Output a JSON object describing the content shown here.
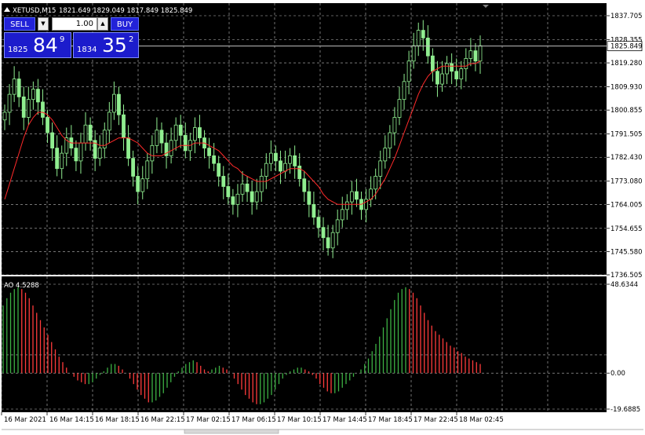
{
  "header": {
    "symbol": "XETUSD,M15",
    "ohlc": "1821.649 1829.049 1817.849 1825.849"
  },
  "trade_panel": {
    "sell_label": "SELL",
    "buy_label": "BUY",
    "lot": "1.00",
    "sell_prefix": "1825",
    "sell_big": "84",
    "sell_sup": "9",
    "buy_prefix": "1834",
    "buy_big": "35",
    "buy_sup": "2"
  },
  "indicator": {
    "label": "AO 4.5288"
  },
  "current_price": "1825.849",
  "colors": {
    "background": "#000000",
    "grid": "#c0c0c0",
    "candle": "#90ee90",
    "ma": "#ff2a2a",
    "ao_up": "#3cb043",
    "ao_down": "#ff3b3b",
    "panel": "#1c1ccc"
  },
  "chart_data": [
    {
      "type": "candlestick",
      "title": "XETUSD,M15",
      "y_ticks": [
        "1837.705",
        "1828.355",
        "1819.280",
        "1809.930",
        "1800.855",
        "1791.505",
        "1782.430",
        "1773.080",
        "1764.005",
        "1754.655",
        "1745.580",
        "1736.505"
      ],
      "ylim": [
        1736.505,
        1837.705
      ],
      "x_ticks": [
        "16 Mar 2021",
        "16 Mar 14:15",
        "16 Mar 18:15",
        "16 Mar 22:15",
        "17 Mar 02:15",
        "17 Mar 06:15",
        "17 Mar 10:15",
        "17 Mar 14:45",
        "17 Mar 18:45",
        "17 Mar 22:45",
        "18 Mar 02:45"
      ],
      "series": [
        {
          "name": "price",
          "values": [
            1800,
            1807,
            1813,
            1806,
            1798,
            1805,
            1809,
            1804,
            1798,
            1792,
            1786,
            1778,
            1784,
            1790,
            1786,
            1781,
            1788,
            1795,
            1789,
            1782,
            1786,
            1793,
            1800,
            1807,
            1799,
            1790,
            1782,
            1775,
            1769,
            1774,
            1781,
            1787,
            1793,
            1788,
            1783,
            1789,
            1795,
            1791,
            1785,
            1789,
            1794,
            1790,
            1786,
            1783,
            1780,
            1775,
            1771,
            1767,
            1764,
            1768,
            1772,
            1769,
            1765,
            1769,
            1775,
            1780,
            1784,
            1781,
            1777,
            1780,
            1783,
            1779,
            1774,
            1769,
            1764,
            1759,
            1755,
            1751,
            1747,
            1753,
            1758,
            1762,
            1765,
            1769,
            1766,
            1762,
            1766,
            1770,
            1775,
            1781,
            1786,
            1792,
            1798,
            1805,
            1812,
            1820,
            1826,
            1832,
            1829,
            1822,
            1816,
            1811,
            1815,
            1819,
            1816,
            1813,
            1817,
            1821,
            1824,
            1820,
            1826
          ]
        },
        {
          "name": "ma",
          "values": [
            1766,
            1772,
            1778,
            1784,
            1790,
            1795,
            1798,
            1800,
            1800,
            1799,
            1797,
            1794,
            1791,
            1789,
            1788,
            1788,
            1788,
            1788,
            1788,
            1788,
            1787,
            1787,
            1788,
            1789,
            1790,
            1790,
            1790,
            1789,
            1788,
            1786,
            1784,
            1783,
            1783,
            1783,
            1784,
            1785,
            1786,
            1787,
            1787,
            1787,
            1788,
            1788,
            1788,
            1787,
            1786,
            1785,
            1783,
            1781,
            1779,
            1778,
            1776,
            1775,
            1774,
            1773,
            1773,
            1773,
            1774,
            1775,
            1776,
            1777,
            1778,
            1778,
            1778,
            1777,
            1775,
            1773,
            1771,
            1768,
            1766,
            1765,
            1764,
            1764,
            1764,
            1764,
            1764,
            1764,
            1765,
            1766,
            1768,
            1771,
            1774,
            1778,
            1782,
            1787,
            1792,
            1797,
            1802,
            1807,
            1811,
            1814,
            1816,
            1817,
            1818,
            1818,
            1818,
            1818,
            1818,
            1818,
            1819,
            1819,
            1820
          ]
        }
      ],
      "current_price": 1825.849
    },
    {
      "type": "histogram",
      "title": "AO 4.5288",
      "y_ticks": [
        "48.6344",
        "0.00",
        "-19.6885"
      ],
      "ylim": [
        -19.6885,
        48.6344
      ],
      "series": [
        {
          "name": "AO",
          "values": [
            37,
            41,
            44,
            46,
            47,
            46,
            44,
            41,
            37,
            33,
            29,
            25,
            21,
            17,
            13,
            9,
            6,
            3,
            0,
            -2,
            -4,
            -5,
            -6,
            -6,
            -5,
            -3,
            -1,
            1,
            3,
            5,
            5,
            4,
            2,
            0,
            -3,
            -6,
            -9,
            -12,
            -14,
            -16,
            -16,
            -15,
            -13,
            -11,
            -8,
            -5,
            -2,
            1,
            3,
            5,
            6,
            7,
            6,
            4,
            2,
            1,
            2,
            3,
            4,
            3,
            2,
            0,
            -3,
            -6,
            -9,
            -12,
            -14,
            -16,
            -17,
            -17,
            -16,
            -14,
            -12,
            -9,
            -6,
            -3,
            -1,
            1,
            2,
            3,
            3,
            2,
            1,
            -1,
            -3,
            -6,
            -8,
            -10,
            -11,
            -11,
            -10,
            -8,
            -6,
            -4,
            -2,
            0,
            2,
            5,
            8,
            12,
            16,
            20,
            25,
            30,
            35,
            40,
            44,
            46,
            47,
            46,
            44,
            41,
            37,
            33,
            29,
            26,
            23,
            21,
            19,
            17,
            15,
            14,
            12,
            11,
            9,
            8,
            7,
            6,
            5
          ]
        }
      ]
    }
  ]
}
